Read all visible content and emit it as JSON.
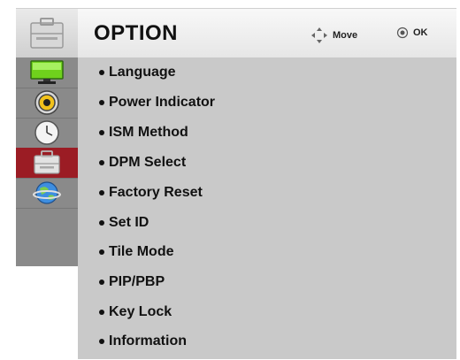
{
  "header": {
    "title": "OPTION",
    "move_label": "Move",
    "ok_label": "OK",
    "icon": "toolbox-icon"
  },
  "sidebar": {
    "items": [
      {
        "icon": "picture-monitor-icon",
        "selected": false
      },
      {
        "icon": "audio-speaker-icon",
        "selected": false
      },
      {
        "icon": "clock-icon",
        "selected": false
      },
      {
        "icon": "toolbox-icon",
        "selected": true
      },
      {
        "icon": "globe-network-icon",
        "selected": false
      }
    ]
  },
  "menu": {
    "items": [
      "Language",
      "Power Indicator",
      "ISM Method",
      "DPM Select",
      "Factory Reset",
      "Set ID",
      "Tile Mode",
      "PIP/PBP",
      "Key Lock",
      "Information"
    ]
  },
  "colors": {
    "selected": "#9b1c24",
    "sidebar": "#8a8a8a",
    "content": "#c9c9c9"
  }
}
